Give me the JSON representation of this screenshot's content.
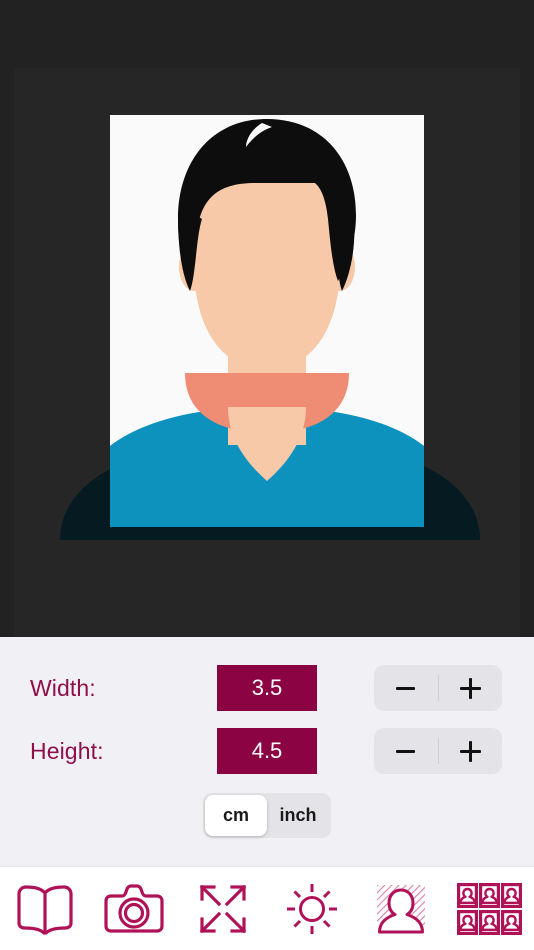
{
  "app": {
    "name": "passport-photo-editor",
    "accent_color": "#8c0344",
    "canvas_background": "#262626",
    "panel_background": "#f1f0f4",
    "toolbar_background": "#ffffff"
  },
  "canvas": {
    "photo": {
      "alt": "passport-portrait-photo",
      "background_color": "#fafafa",
      "skin_color": "#f7c9a8",
      "hair_color": "#0d0d0d",
      "shirt_color": "#0c92bd",
      "neck_shadow_color": "#ef8d74",
      "shoulder_overflow_color": "#061a22"
    }
  },
  "controls": {
    "width": {
      "label": "Width:",
      "value": "3.5",
      "decrement_label": "−",
      "increment_label": "+"
    },
    "height": {
      "label": "Height:",
      "value": "4.5",
      "decrement_label": "−",
      "increment_label": "+"
    },
    "units": {
      "selected": "cm",
      "options": [
        {
          "label": "cm",
          "selected": true
        },
        {
          "label": "inch",
          "selected": false
        }
      ]
    }
  },
  "toolbar": {
    "items": [
      {
        "icon": "open-book-icon",
        "label": "Gallery"
      },
      {
        "icon": "camera-icon",
        "label": "Camera"
      },
      {
        "icon": "expand-arrows-icon",
        "label": "Crop / Resize"
      },
      {
        "icon": "brightness-sun-icon",
        "label": "Brightness"
      },
      {
        "icon": "person-background-icon",
        "label": "Background"
      },
      {
        "icon": "photo-grid-icon",
        "label": "Photo Sheet"
      }
    ]
  }
}
